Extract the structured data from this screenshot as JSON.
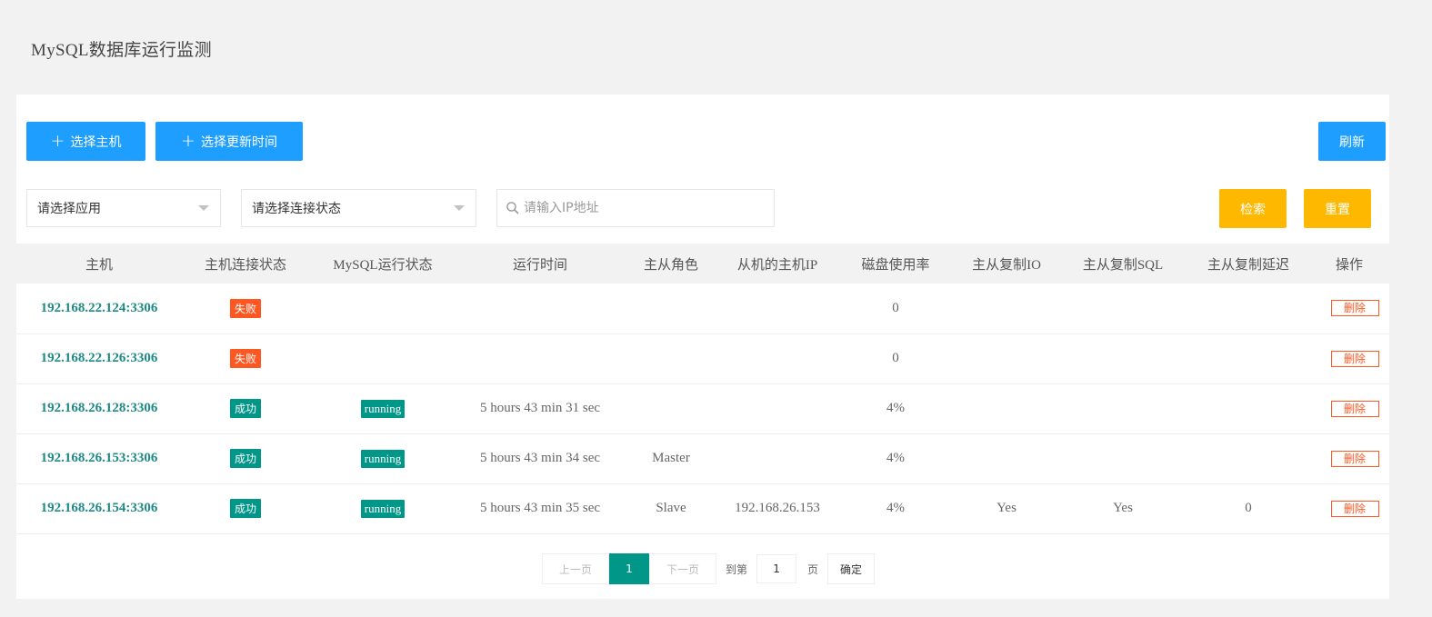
{
  "page": {
    "title": "MySQL数据库运行监测"
  },
  "toolbar": {
    "select_host_label": "选择主机",
    "select_time_label": "选择更新时间",
    "refresh_label": "刷新",
    "plus_glyph": "+"
  },
  "filters": {
    "app_select": "请选择应用",
    "status_select": "请选择连接状态",
    "ip_placeholder": "请输入IP地址",
    "search_label": "检索",
    "reset_label": "重置"
  },
  "table": {
    "headers": [
      "主机",
      "主机连接状态",
      "MySQL运行状态",
      "运行时间",
      "主从角色",
      "从机的主机IP",
      "磁盘使用率",
      "主从复制IO",
      "主从复制SQL",
      "主从复制延迟",
      "操作"
    ],
    "rows": [
      {
        "host": "192.168.22.124:3306",
        "conn": "失败",
        "conn_ok": false,
        "mysql": "",
        "uptime": "",
        "role": "",
        "slave_ip": "",
        "disk": "0",
        "io": "",
        "sql": "",
        "delay": "",
        "action": "删除"
      },
      {
        "host": "192.168.22.126:3306",
        "conn": "失败",
        "conn_ok": false,
        "mysql": "",
        "uptime": "",
        "role": "",
        "slave_ip": "",
        "disk": "0",
        "io": "",
        "sql": "",
        "delay": "",
        "action": "删除"
      },
      {
        "host": "192.168.26.128:3306",
        "conn": "成功",
        "conn_ok": true,
        "mysql": "running",
        "uptime": "5 hours 43 min 31 sec",
        "role": "",
        "slave_ip": "",
        "disk": "4%",
        "io": "",
        "sql": "",
        "delay": "",
        "action": "删除"
      },
      {
        "host": "192.168.26.153:3306",
        "conn": "成功",
        "conn_ok": true,
        "mysql": "running",
        "uptime": "5 hours 43 min 34 sec",
        "role": "Master",
        "slave_ip": "",
        "disk": "4%",
        "io": "",
        "sql": "",
        "delay": "",
        "action": "删除"
      },
      {
        "host": "192.168.26.154:3306",
        "conn": "成功",
        "conn_ok": true,
        "mysql": "running",
        "uptime": "5 hours 43 min 35 sec",
        "role": "Slave",
        "slave_ip": "192.168.26.153",
        "disk": "4%",
        "io": "Yes",
        "sql": "Yes",
        "delay": "0",
        "action": "删除"
      }
    ]
  },
  "pagination": {
    "prev": "上一页",
    "current": "1",
    "next": "下一页",
    "goto_label": "到第",
    "page_value": "1",
    "page_suffix": "页",
    "confirm": "确定"
  },
  "colors": {
    "primary": "#1e9fff",
    "warn": "#ffb800",
    "danger": "#ff5722",
    "success": "#009688",
    "host_link": "#1e8a86"
  }
}
